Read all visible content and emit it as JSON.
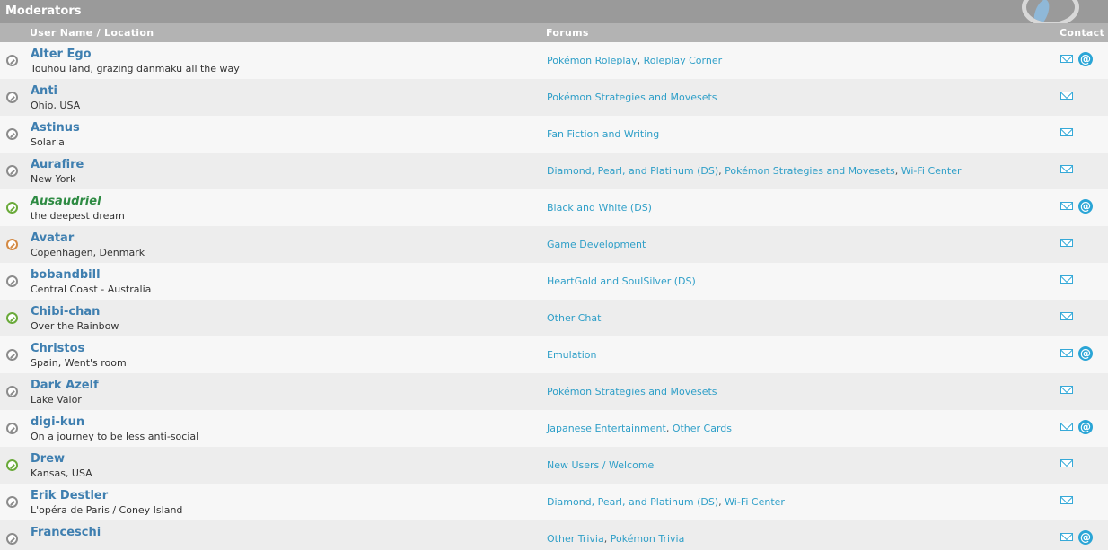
{
  "panel": {
    "title": "Moderators",
    "columns": {
      "user": "User Name / Location",
      "forums": "Forums",
      "contact": "Contact"
    }
  },
  "icons": {
    "status": "status-icon",
    "mail": "mail-icon",
    "im": "at-icon"
  },
  "colors": {
    "title_bar": "#9a9a9a",
    "column_header": "#b3b3b3",
    "username": "#3f7fb0",
    "forum_link": "#2f9fc8",
    "online": "#6aaa3a",
    "away": "#d48a44",
    "offline": "#8c8c8c"
  },
  "moderators": [
    {
      "name": "Alter Ego",
      "location": "Touhou land, grazing danmaku all the way",
      "status": "offline",
      "forums": [
        "Pokémon Roleplay",
        "Roleplay Corner"
      ],
      "im": true
    },
    {
      "name": "Anti",
      "location": "Ohio, USA",
      "status": "offline",
      "forums": [
        "Pokémon Strategies and Movesets"
      ],
      "im": false
    },
    {
      "name": "Astinus",
      "location": "Solaria",
      "status": "offline",
      "forums": [
        "Fan Fiction and Writing"
      ],
      "im": false
    },
    {
      "name": "Aurafire",
      "location": "New York",
      "status": "offline",
      "forums": [
        "Diamond, Pearl, and Platinum (DS)",
        "Pokémon Strategies and Movesets",
        "Wi-Fi Center"
      ],
      "im": false
    },
    {
      "name": "Ausaudriel",
      "location": "the deepest dream",
      "status": "online",
      "style": "italic-green",
      "forums": [
        "Black and White (DS)"
      ],
      "im": true
    },
    {
      "name": "Avatar",
      "location": "Copenhagen, Denmark",
      "status": "away",
      "forums": [
        "Game Development"
      ],
      "im": false
    },
    {
      "name": "bobandbill",
      "location": "Central Coast - Australia",
      "status": "offline",
      "forums": [
        "HeartGold and SoulSilver (DS)"
      ],
      "im": false
    },
    {
      "name": "Chibi-chan",
      "location": "Over the Rainbow",
      "status": "online",
      "forums": [
        "Other Chat"
      ],
      "im": false
    },
    {
      "name": "Christos",
      "location": "Spain, Went's room",
      "status": "offline",
      "forums": [
        "Emulation"
      ],
      "im": true
    },
    {
      "name": "Dark Azelf",
      "location": "Lake Valor",
      "status": "offline",
      "forums": [
        "Pokémon Strategies and Movesets"
      ],
      "im": false
    },
    {
      "name": "digi-kun",
      "location": "On a journey to be less anti-social",
      "status": "offline",
      "forums": [
        "Japanese Entertainment",
        "Other Cards"
      ],
      "im": true
    },
    {
      "name": "Drew",
      "location": "Kansas, USA",
      "status": "online",
      "forums": [
        "New Users / Welcome"
      ],
      "im": false
    },
    {
      "name": "Erik Destler",
      "location": "L'opéra de Paris / Coney Island",
      "status": "offline",
      "forums": [
        "Diamond, Pearl, and Platinum (DS)",
        "Wi-Fi Center"
      ],
      "im": false
    },
    {
      "name": "Franceschi",
      "location": "",
      "status": "offline",
      "forums": [
        "Other Trivia",
        "Pokémon Trivia"
      ],
      "im": true
    }
  ]
}
